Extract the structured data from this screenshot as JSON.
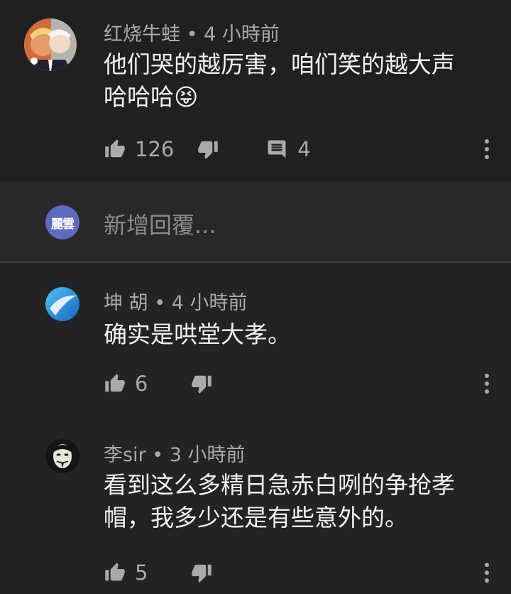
{
  "comments": [
    {
      "author": "红烧牛蛙",
      "time": "4 小時前",
      "text_line1": "他们哭的越厉害，咱们笑的越大声",
      "text_line2": "哈哈哈",
      "emoji": "😝",
      "likes": "126",
      "replies": "4",
      "avatar_icon": "collage-photo-icon"
    },
    {
      "author": "坤 胡",
      "time": "4 小時前",
      "text_line1": "确实是哄堂大孝。",
      "likes": "6",
      "avatar_icon": "blue-orb-icon"
    },
    {
      "author": "李sir",
      "time": "3 小時前",
      "text_line1": "看到这么多精日急赤白咧的争抢孝",
      "text_line2": "帽，我多少还是有些意外的。",
      "likes": "5",
      "avatar_icon": "mask-face-icon"
    }
  ],
  "reply_box": {
    "avatar_text": "麗雲",
    "placeholder": "新增回覆..."
  },
  "separator": "•",
  "colors": {
    "background": "#232323",
    "text": "#f1f1f1",
    "secondary": "#aaaaaa",
    "reply_avatar": "#5c6bc0"
  }
}
